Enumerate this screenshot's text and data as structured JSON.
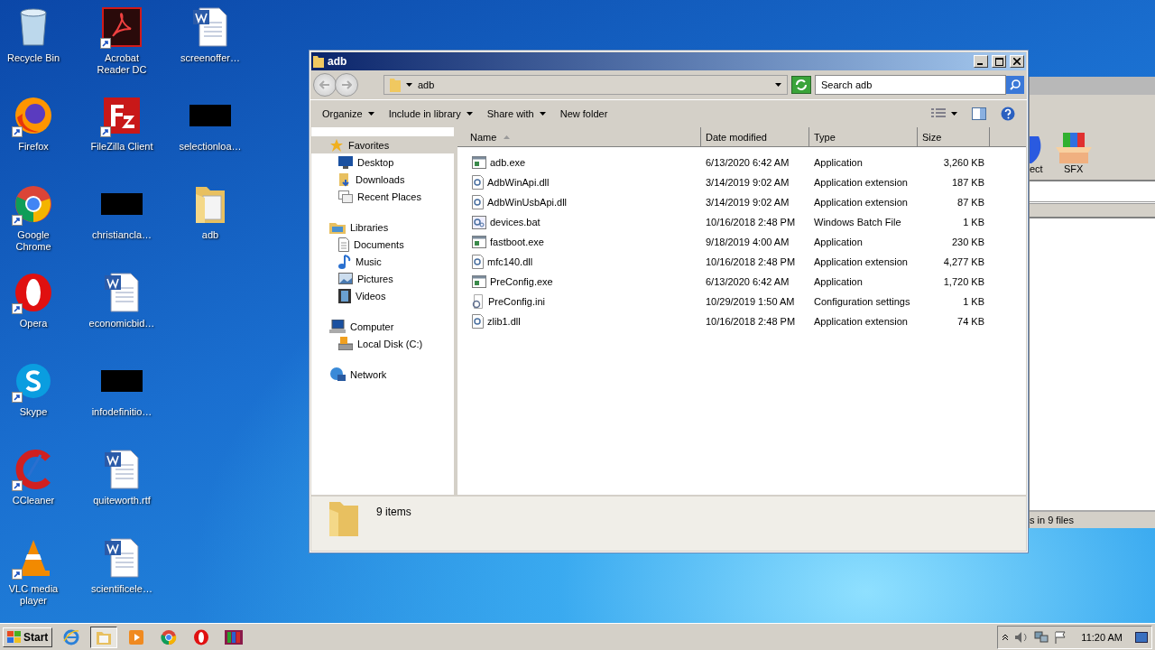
{
  "desktop_icons": [
    {
      "label": "Recycle Bin",
      "kind": "recycle",
      "shortcut": false
    },
    {
      "label": "Firefox",
      "kind": "firefox",
      "shortcut": true
    },
    {
      "label": "Google Chrome",
      "kind": "chrome",
      "shortcut": true
    },
    {
      "label": "Opera",
      "kind": "opera",
      "shortcut": true
    },
    {
      "label": "Skype",
      "kind": "skype",
      "shortcut": true
    },
    {
      "label": "CCleaner",
      "kind": "ccleaner",
      "shortcut": true
    },
    {
      "label": "VLC media player",
      "kind": "vlc",
      "shortcut": true
    },
    {
      "label": "Acrobat Reader DC",
      "kind": "acrobat",
      "shortcut": true
    },
    {
      "label": "FileZilla Client",
      "kind": "filezilla",
      "shortcut": true
    },
    {
      "label": "christiancla…",
      "kind": "redacted",
      "shortcut": false
    },
    {
      "label": "economicbid…",
      "kind": "word",
      "shortcut": false
    },
    {
      "label": "infodefinitio…",
      "kind": "redacted",
      "shortcut": false
    },
    {
      "label": "quiteworth.rtf",
      "kind": "word",
      "shortcut": false
    },
    {
      "label": "scientificele…",
      "kind": "word",
      "shortcut": false
    },
    {
      "label": "screenoffer…",
      "kind": "word",
      "shortcut": false
    },
    {
      "label": "selectionloa…",
      "kind": "redacted",
      "shortcut": false
    },
    {
      "label": "adb",
      "kind": "folder",
      "shortcut": false
    }
  ],
  "background_window": {
    "toolbar_items": [
      {
        "label": "ect",
        "kind": "shield"
      },
      {
        "label": "SFX",
        "kind": "box"
      }
    ],
    "status": "s in 9 files"
  },
  "window": {
    "title": "adb",
    "address": "adb",
    "search": {
      "placeholder": "Search adb"
    },
    "commands": [
      {
        "label": "Organize",
        "menu": true
      },
      {
        "label": "Include in library",
        "menu": true
      },
      {
        "label": "Share with",
        "menu": true
      },
      {
        "label": "New folder",
        "menu": false
      }
    ],
    "nav": [
      {
        "label": "Favorites",
        "kind": "star",
        "selected": true,
        "children": [
          {
            "label": "Desktop",
            "kind": "desktop",
            "selected": false
          },
          {
            "label": "Downloads",
            "kind": "downloads",
            "selected": false
          },
          {
            "label": "Recent Places",
            "kind": "recent",
            "selected": false
          }
        ]
      },
      {
        "label": "Libraries",
        "kind": "libraries",
        "selected": false,
        "children": [
          {
            "label": "Documents",
            "kind": "documents",
            "selected": false
          },
          {
            "label": "Music",
            "kind": "music",
            "selected": false
          },
          {
            "label": "Pictures",
            "kind": "pictures",
            "selected": false
          },
          {
            "label": "Videos",
            "kind": "videos",
            "selected": false
          }
        ]
      },
      {
        "label": "Computer",
        "kind": "computer",
        "selected": false,
        "children": [
          {
            "label": "Local Disk (C:)",
            "kind": "disk",
            "selected": false
          }
        ]
      },
      {
        "label": "Network",
        "kind": "network",
        "selected": false
      }
    ],
    "columns": [
      "Name",
      "Date modified",
      "Type",
      "Size"
    ],
    "files": [
      {
        "name": "adb.exe",
        "date": "6/13/2020 6:42 AM",
        "type": "Application",
        "size": "3,260 KB",
        "kind": "exe"
      },
      {
        "name": "AdbWinApi.dll",
        "date": "3/14/2019 9:02 AM",
        "type": "Application extension",
        "size": "187 KB",
        "kind": "dll"
      },
      {
        "name": "AdbWinUsbApi.dll",
        "date": "3/14/2019 9:02 AM",
        "type": "Application extension",
        "size": "87 KB",
        "kind": "dll"
      },
      {
        "name": "devices.bat",
        "date": "10/16/2018 2:48 PM",
        "type": "Windows Batch File",
        "size": "1 KB",
        "kind": "bat"
      },
      {
        "name": "fastboot.exe",
        "date": "9/18/2019 4:00 AM",
        "type": "Application",
        "size": "230 KB",
        "kind": "exe"
      },
      {
        "name": "mfc140.dll",
        "date": "10/16/2018 2:48 PM",
        "type": "Application extension",
        "size": "4,277 KB",
        "kind": "dll"
      },
      {
        "name": "PreConfig.exe",
        "date": "6/13/2020 6:42 AM",
        "type": "Application",
        "size": "1,720 KB",
        "kind": "exe"
      },
      {
        "name": "PreConfig.ini",
        "date": "10/29/2019 1:50 AM",
        "type": "Configuration settings",
        "size": "1 KB",
        "kind": "ini"
      },
      {
        "name": "zlib1.dll",
        "date": "10/16/2018 2:48 PM",
        "type": "Application extension",
        "size": "74 KB",
        "kind": "dll"
      }
    ],
    "details": "9 items"
  },
  "taskbar": {
    "start": "Start",
    "apps": [
      {
        "kind": "ie",
        "selected": false
      },
      {
        "kind": "explorer",
        "selected": true
      },
      {
        "kind": "media",
        "selected": false
      },
      {
        "kind": "chrome",
        "selected": false
      },
      {
        "kind": "opera",
        "selected": false
      },
      {
        "kind": "winrar",
        "selected": false
      }
    ],
    "time": "11:20 AM"
  }
}
